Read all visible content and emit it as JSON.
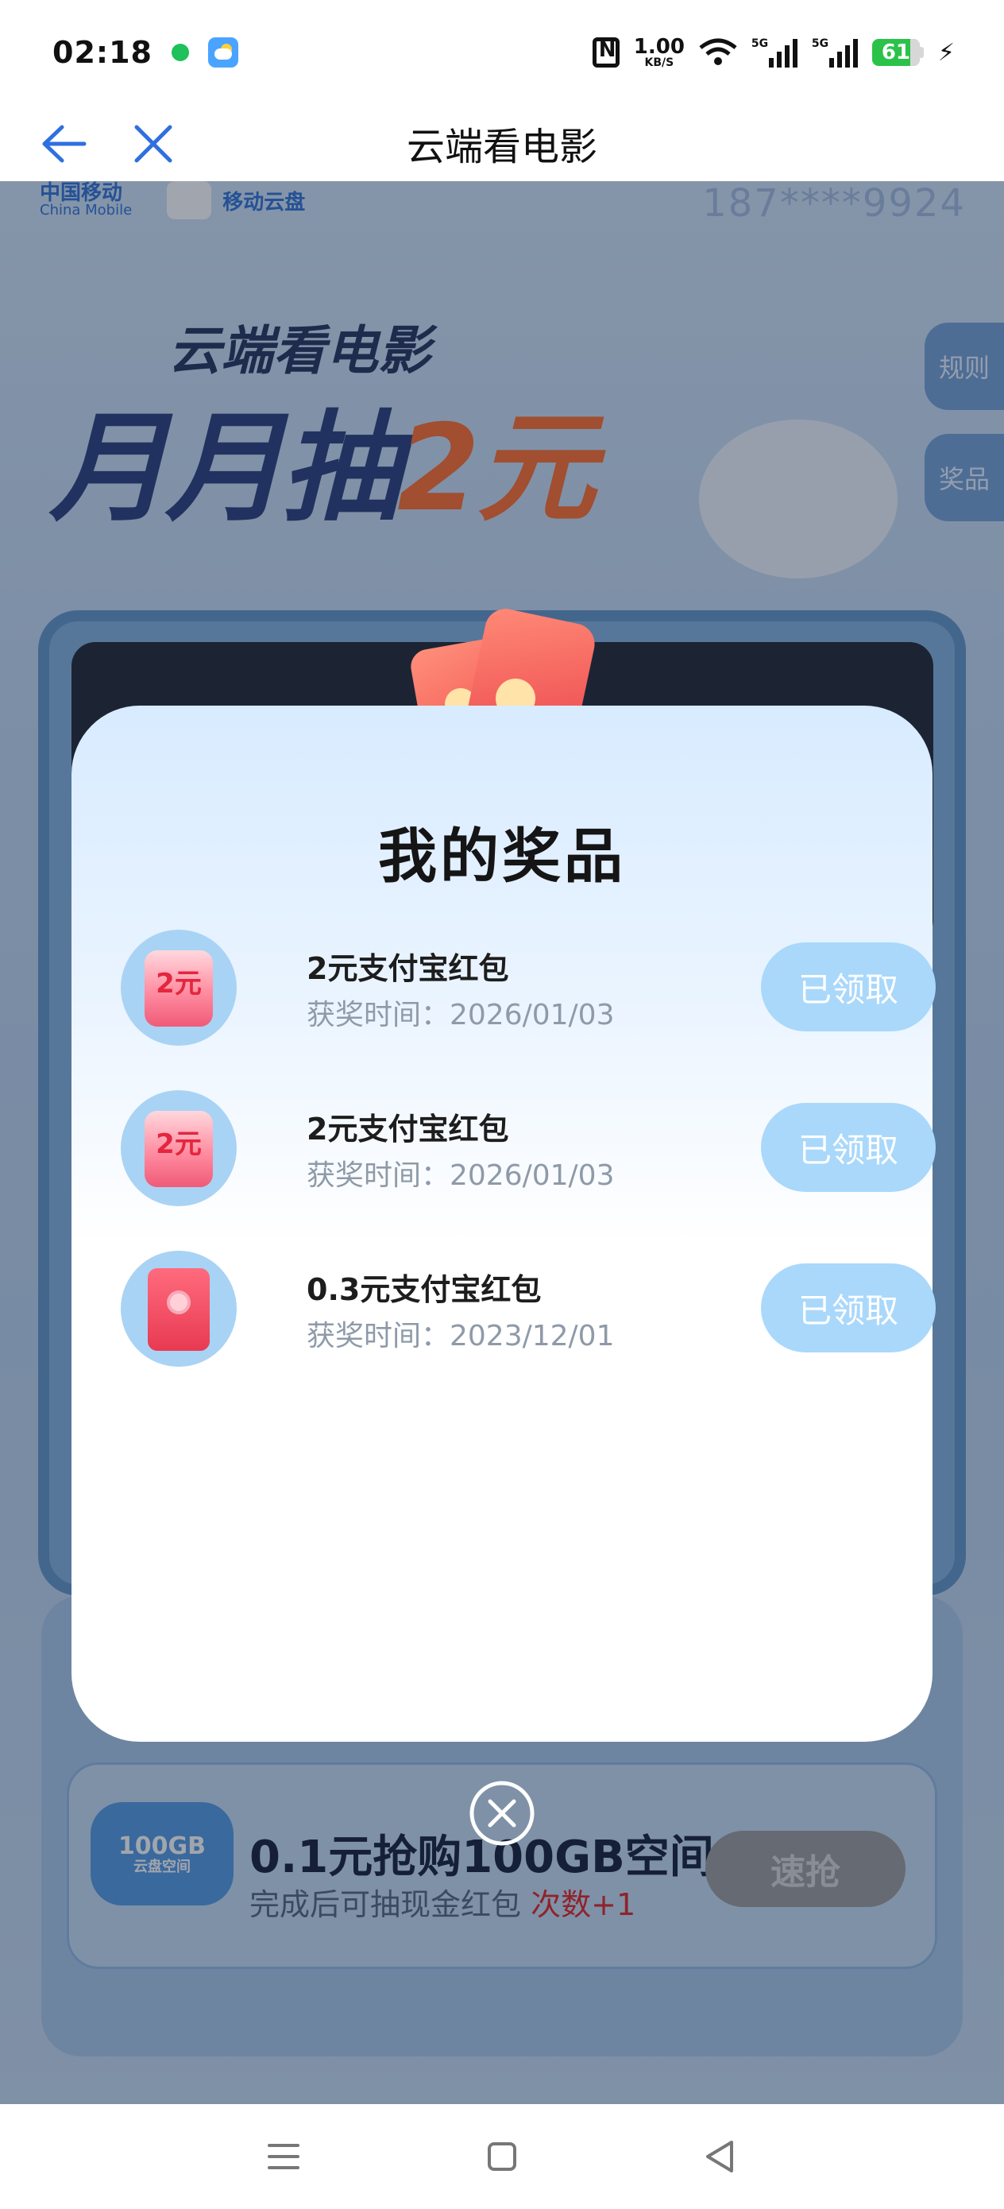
{
  "status_bar": {
    "time": "02:18",
    "speed_value": "1.00",
    "speed_unit": "KB/S",
    "sim1_label": "5G",
    "sim2_label": "5G",
    "battery": "61"
  },
  "nav": {
    "title": "云端看电影"
  },
  "background": {
    "brand_cn": "中国移动",
    "brand_en": "China Mobile",
    "cloud_brand": "移动云盘",
    "phone": "187****9924",
    "subtitle": "云端看电影",
    "title_prefix": "月月抽",
    "title_highlight": "2元",
    "rules_label": "规则",
    "prizes_label": "奖品",
    "promo_badge_main": "100GB",
    "promo_badge_sub": "云盘空间",
    "promo_title": "0.1元抢购100GB空间",
    "promo_sub": "完成后可抽现金红包",
    "promo_bonus": "次数+1",
    "promo_button": "速抢"
  },
  "modal": {
    "title": "我的奖品",
    "prizes": [
      {
        "icon": "red-packet-2yuan",
        "icon_text": "2元",
        "name": "2元支付宝红包",
        "time": "获奖时间：2026/01/03",
        "button": "已领取"
      },
      {
        "icon": "red-packet-2yuan",
        "icon_text": "2元",
        "name": "2元支付宝红包",
        "time": "获奖时间：2026/01/03",
        "button": "已领取"
      },
      {
        "icon": "red-envelope",
        "icon_text": "",
        "name": "0.3元支付宝红包",
        "time": "获奖时间：2023/12/01",
        "button": "已领取"
      }
    ]
  },
  "colors": {
    "accent_blue": "#2f6fe0",
    "claimed_button": "#a9d8fb",
    "overlay": "#1e283c"
  }
}
